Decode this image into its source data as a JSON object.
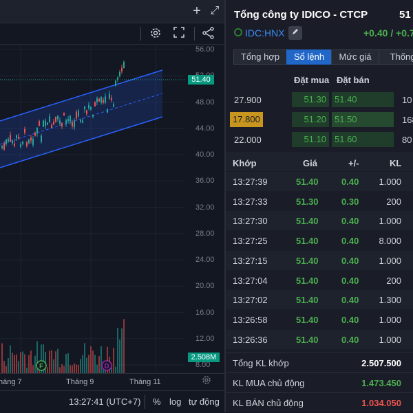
{
  "chart": {
    "price_ticks": [
      "56.00",
      "52.00",
      "48.00",
      "44.00",
      "40.00",
      "36.00",
      "32.00",
      "28.00",
      "24.00",
      "20.00",
      "16.00",
      "12.00",
      "8.00"
    ],
    "last_price_label": "51.40",
    "volume_label": "2.508M",
    "time_ticks": [
      "háng 7",
      "Tháng 9",
      "Tháng 11"
    ],
    "markers": [
      "F",
      "D"
    ],
    "clock": "13:27:41 (UTC+7)",
    "percent_label": "%",
    "log_label": "log",
    "auto_label": "tự động",
    "colors": {
      "up": "#26a69a",
      "down": "#ef5350",
      "channel": "#2962ff"
    }
  },
  "topbar": {
    "add_icon": "+",
    "expand_icon": "⤢"
  },
  "toolbar": {
    "icons": [
      "gear-icon",
      "fullscreen-icon",
      "share-icon"
    ]
  },
  "header": {
    "company": "Tổng công ty IDICO - CTCP",
    "price": "51",
    "ticker": "IDC:HNX",
    "change": "+0.40 / +0.7"
  },
  "tabs": [
    "Tổng hợp",
    "Sổ lệnh",
    "Mức giá",
    "Thống"
  ],
  "orderbook": {
    "headers": {
      "bid": "Đặt mua",
      "ask": "Đặt bán"
    },
    "rows": [
      {
        "bid_vol": "27.900",
        "bid": "51.30",
        "ask": "51.40",
        "ask_vol": "10"
      },
      {
        "bid_vol": "17.800",
        "bid": "51.20",
        "ask": "51.50",
        "ask_vol": "168"
      },
      {
        "bid_vol": "22.000",
        "bid": "51.10",
        "ask": "51.60",
        "ask_vol": "80"
      }
    ]
  },
  "trades": {
    "headers": {
      "time": "Khớp",
      "price": "Giá",
      "change": "+/-",
      "vol": "KL"
    },
    "rows": [
      {
        "time": "13:27:39",
        "price": "51.40",
        "change": "0.40",
        "vol": "1.000"
      },
      {
        "time": "13:27:33",
        "price": "51.30",
        "change": "0.30",
        "vol": "200"
      },
      {
        "time": "13:27:30",
        "price": "51.40",
        "change": "0.40",
        "vol": "1.000"
      },
      {
        "time": "13:27:25",
        "price": "51.40",
        "change": "0.40",
        "vol": "8.000"
      },
      {
        "time": "13:27:15",
        "price": "51.40",
        "change": "0.40",
        "vol": "1.000"
      },
      {
        "time": "13:27:04",
        "price": "51.40",
        "change": "0.40",
        "vol": "200"
      },
      {
        "time": "13:27:02",
        "price": "51.40",
        "change": "0.40",
        "vol": "1.300"
      },
      {
        "time": "13:26:58",
        "price": "51.40",
        "change": "0.40",
        "vol": "1.000"
      },
      {
        "time": "13:26:36",
        "price": "51.40",
        "change": "0.40",
        "vol": "1.000"
      }
    ]
  },
  "summary": [
    {
      "label": "Tổng KL khớp",
      "value": "2.507.500",
      "color": "#ffffff"
    },
    {
      "label": "KL MUA chủ động",
      "value": "1.473.450",
      "color": "#4caf50"
    },
    {
      "label": "KL BÁN chủ động",
      "value": "1.034.050",
      "color": "#ef5350"
    }
  ]
}
